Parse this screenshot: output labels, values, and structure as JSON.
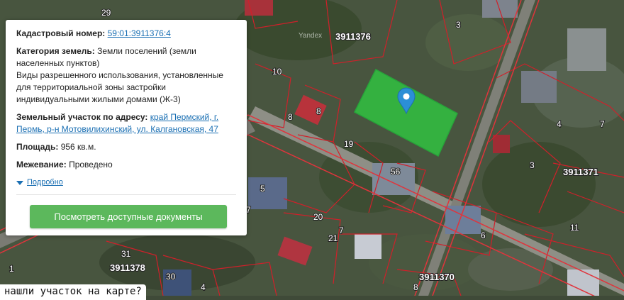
{
  "map": {
    "provider_watermark": "Yandex",
    "block_labels": [
      "3911376",
      "3911371",
      "3911378",
      "3911370"
    ],
    "house_numbers": [
      "29",
      "3",
      "10",
      "8",
      "8",
      "19",
      "56",
      "4",
      "7",
      "3",
      "5",
      "7",
      "20",
      "21",
      "6",
      "11",
      "31",
      "30",
      "4",
      "8",
      "7",
      "1"
    ]
  },
  "info_card": {
    "cadastral_number_label": "Кадастровый номер:",
    "cadastral_number_value": "59:01:3911376:4",
    "land_category_label": "Категория земель:",
    "land_category_value": "Земли поселений (земли населенных пунктов)",
    "permitted_use_text": "Виды разрешенного использования, установленные для территориальной зоны застройки индивидуальными жилыми домами (Ж-3)",
    "address_label": "Земельный участок по адресу:",
    "address_value": "край Пермский, г. Пермь, р-н Мотовилихинский, ул. Калгановская, 47",
    "area_label": "Площадь:",
    "area_value": "956 кв.м.",
    "survey_label": "Межевание:",
    "survey_value": "Проведено",
    "more_label": "Подробно",
    "docs_button_label": "Посмотреть доступные документы"
  },
  "bottom_question": "нашли участок на карте?",
  "colors": {
    "plot_fill": "#2ecc40",
    "button_green": "#5cb85c",
    "link_blue": "#1a6fb3",
    "marker_blue": "#2b8fd6",
    "parcel_border": "#d0202a"
  },
  "icons": [
    "map-marker-icon",
    "triangle-down-icon"
  ]
}
